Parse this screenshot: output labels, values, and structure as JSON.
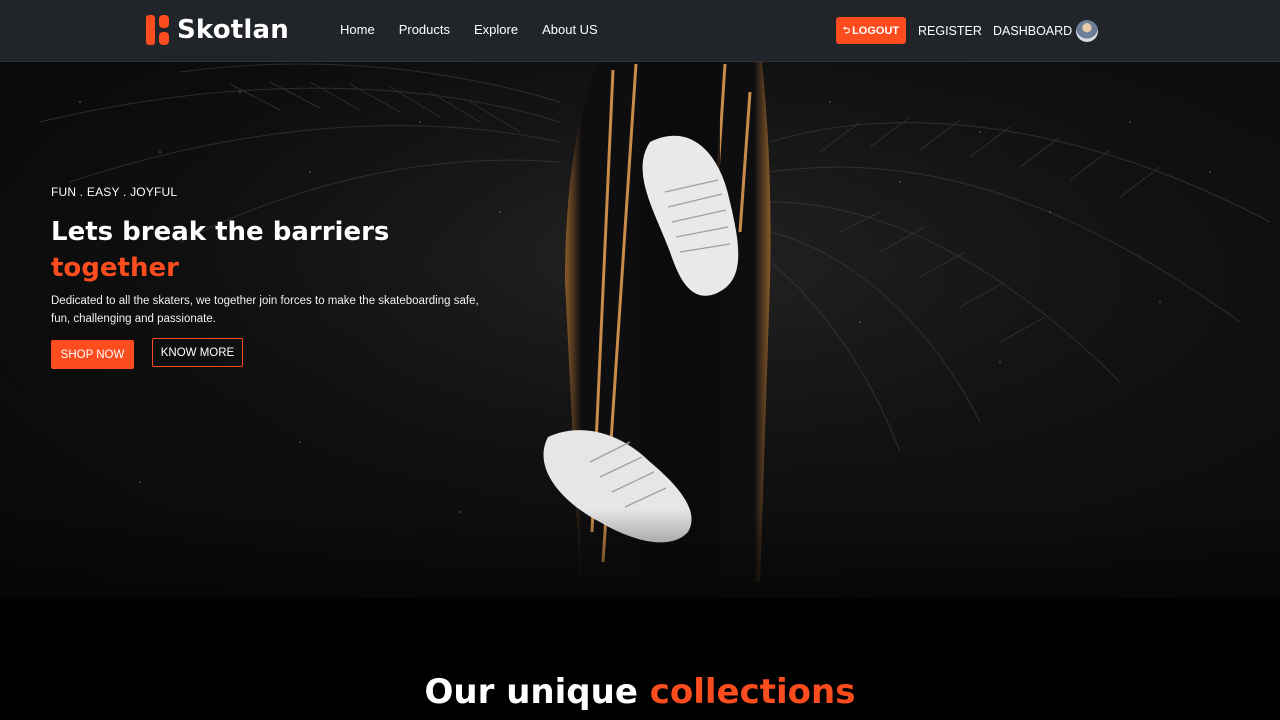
{
  "brand": {
    "name": "Skotlan",
    "accent_color": "#fd4d1f"
  },
  "nav": {
    "links": [
      "Home",
      "Products",
      "Explore",
      "About US"
    ],
    "logout_label": "LOGOUT",
    "logout_icon": "sign-out-icon",
    "register_label": "REGISTER",
    "dashboard_label": "DASHBOARD",
    "avatar_icon": "user-avatar"
  },
  "hero": {
    "eyebrow": "FUN . EASY . JOYFUL",
    "title_line1": "Lets break the barriers",
    "title_accent": "together",
    "description": "Dedicated to all the skaters, we together join forces to make the skateboarding safe, fun, challenging and passionate.",
    "shop_label": "SHOP NOW",
    "know_label": "KNOW MORE"
  },
  "collections": {
    "title_plain": "Our unique",
    "title_accent": "collections"
  }
}
